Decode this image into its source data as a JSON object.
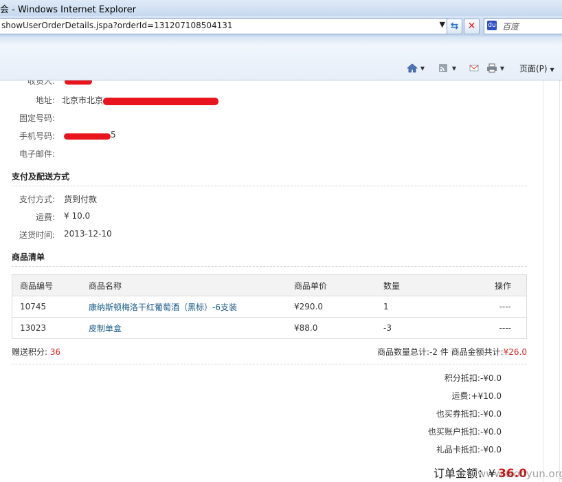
{
  "browser": {
    "title": "会 - Windows Internet Explorer",
    "url": "showUserOrderDetails.jspa?orderId=131207108504131",
    "search_placeholder": "百度",
    "page_menu": "页面(P)"
  },
  "shipping": {
    "receiver_label": "收货人:",
    "address_label": "地址:",
    "address_value": "北京市北京",
    "phone_label": "固定号码:",
    "mobile_label": "手机号码:",
    "mobile_value": "5",
    "email_label": "电子邮件:"
  },
  "payment": {
    "section_title": "支付及配送方式",
    "method_label": "支付方式:",
    "method_value": "货到付款",
    "freight_label": "运费:",
    "freight_value": "¥ 10.0",
    "delivery_label": "送货时间:",
    "delivery_value": "2013-12-10"
  },
  "items": {
    "section_title": "商品清单",
    "headers": [
      "商品编号",
      "商品名称",
      "商品单价",
      "数量",
      "操作"
    ],
    "rows": [
      {
        "id": "10745",
        "name": "康纳斯顿梅洛干红葡萄酒（黑标）-6支装",
        "price": "¥290.0",
        "qty": "1",
        "op": "----"
      },
      {
        "id": "13023",
        "name": "皮制单盒",
        "price": "¥88.0",
        "qty": "-3",
        "op": "----"
      }
    ]
  },
  "summary": {
    "points_label": "赠送积分:",
    "points_value": "36",
    "count_label": "商品数量总计:",
    "count_value": "-2 件",
    "amount_label": "商品金额共计:",
    "amount_value": "¥26.0"
  },
  "deductions": [
    {
      "label": "积分抵扣:",
      "value": "-¥0.0"
    },
    {
      "label": "运费:",
      "value": "+¥10.0"
    },
    {
      "label": "也买券抵扣:",
      "value": "-¥0.0"
    },
    {
      "label": "也买账户抵扣:",
      "value": "-¥0.0"
    },
    {
      "label": "礼品卡抵扣:",
      "value": "-¥0.0"
    }
  ],
  "total": {
    "label": "订单金额：¥",
    "value": "36.0"
  },
  "watermark": "www.wooyun.org",
  "colors": {
    "accent_red": "#d21414",
    "link": "#1a5c8a"
  }
}
